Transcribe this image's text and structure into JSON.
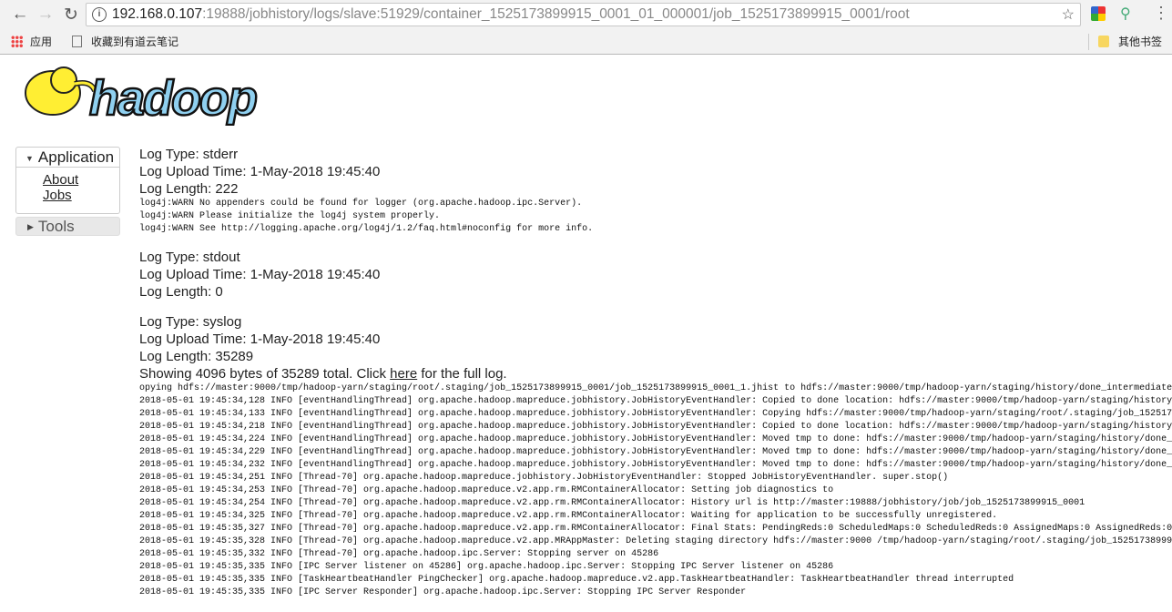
{
  "browser": {
    "url_host": "192.168.0.107",
    "url_path": ":19888/jobhistory/logs/slave:51929/container_1525173899915_0001_01_000001/job_1525173899915_0001/root",
    "bookmarks": [
      "应用",
      "收藏到有道云笔记"
    ],
    "other_bookmarks": "其他书签"
  },
  "logo": {
    "text": "hadoop"
  },
  "sidebar": {
    "application": "Application",
    "links": [
      "About",
      "Jobs"
    ],
    "tools": "Tools"
  },
  "logs": [
    {
      "type": "Log Type: stderr",
      "upload": "Log Upload Time: 1-May-2018 19:45:40",
      "length": "Log Length: 222",
      "lines": [
        "log4j:WARN No appenders could be found for logger (org.apache.hadoop.ipc.Server).",
        "log4j:WARN Please initialize the log4j system properly.",
        "log4j:WARN See http://logging.apache.org/log4j/1.2/faq.html#noconfig for more info."
      ]
    },
    {
      "type": "Log Type: stdout",
      "upload": "Log Upload Time: 1-May-2018 19:45:40",
      "length": "Log Length: 0",
      "lines": []
    },
    {
      "type": "Log Type: syslog",
      "upload": "Log Upload Time: 1-May-2018 19:45:40",
      "length": "Log Length: 35289",
      "showing_pre": "Showing 4096 bytes of 35289 total. Click ",
      "here": "here",
      "showing_post": " for the full log.",
      "lines": [
        "opying hdfs://master:9000/tmp/hadoop-yarn/staging/root/.staging/job_1525173899915_0001/job_1525173899915_0001_1.jhist to hdfs://master:9000/tmp/hadoop-yarn/staging/history/done_intermediate",
        "2018-05-01 19:45:34,128 INFO [eventHandlingThread] org.apache.hadoop.mapreduce.jobhistory.JobHistoryEventHandler: Copied to done location: hdfs://master:9000/tmp/hadoop-yarn/staging/history",
        "2018-05-01 19:45:34,133 INFO [eventHandlingThread] org.apache.hadoop.mapreduce.jobhistory.JobHistoryEventHandler: Copying hdfs://master:9000/tmp/hadoop-yarn/staging/root/.staging/job_152517",
        "2018-05-01 19:45:34,218 INFO [eventHandlingThread] org.apache.hadoop.mapreduce.jobhistory.JobHistoryEventHandler: Copied to done location: hdfs://master:9000/tmp/hadoop-yarn/staging/history",
        "2018-05-01 19:45:34,224 INFO [eventHandlingThread] org.apache.hadoop.mapreduce.jobhistory.JobHistoryEventHandler: Moved tmp to done: hdfs://master:9000/tmp/hadoop-yarn/staging/history/done_",
        "2018-05-01 19:45:34,229 INFO [eventHandlingThread] org.apache.hadoop.mapreduce.jobhistory.JobHistoryEventHandler: Moved tmp to done: hdfs://master:9000/tmp/hadoop-yarn/staging/history/done_",
        "2018-05-01 19:45:34,232 INFO [eventHandlingThread] org.apache.hadoop.mapreduce.jobhistory.JobHistoryEventHandler: Moved tmp to done: hdfs://master:9000/tmp/hadoop-yarn/staging/history/done_",
        "2018-05-01 19:45:34,251 INFO [Thread-70] org.apache.hadoop.mapreduce.jobhistory.JobHistoryEventHandler: Stopped JobHistoryEventHandler. super.stop()",
        "2018-05-01 19:45:34,253 INFO [Thread-70] org.apache.hadoop.mapreduce.v2.app.rm.RMContainerAllocator: Setting job diagnostics to",
        "2018-05-01 19:45:34,254 INFO [Thread-70] org.apache.hadoop.mapreduce.v2.app.rm.RMContainerAllocator: History url is http://master:19888/jobhistory/job/job_1525173899915_0001",
        "2018-05-01 19:45:34,325 INFO [Thread-70] org.apache.hadoop.mapreduce.v2.app.rm.RMContainerAllocator: Waiting for application to be successfully unregistered.",
        "2018-05-01 19:45:35,327 INFO [Thread-70] org.apache.hadoop.mapreduce.v2.app.rm.RMContainerAllocator: Final Stats: PendingReds:0 ScheduledMaps:0 ScheduledReds:0 AssignedMaps:0 AssignedReds:0",
        "2018-05-01 19:45:35,328 INFO [Thread-70] org.apache.hadoop.mapreduce.v2.app.MRAppMaster: Deleting staging directory hdfs://master:9000 /tmp/hadoop-yarn/staging/root/.staging/job_15251738999",
        "2018-05-01 19:45:35,332 INFO [Thread-70] org.apache.hadoop.ipc.Server: Stopping server on 45286",
        "2018-05-01 19:45:35,335 INFO [IPC Server listener on 45286] org.apache.hadoop.ipc.Server: Stopping IPC Server listener on 45286",
        "2018-05-01 19:45:35,335 INFO [TaskHeartbeatHandler PingChecker] org.apache.hadoop.mapreduce.v2.app.TaskHeartbeatHandler: TaskHeartbeatHandler thread interrupted",
        "2018-05-01 19:45:35,335 INFO [IPC Server Responder] org.apache.hadoop.ipc.Server: Stopping IPC Server Responder"
      ]
    }
  ],
  "colors": {
    "logo_blue": "#8fd0f0",
    "elephant": "#ffee33"
  }
}
